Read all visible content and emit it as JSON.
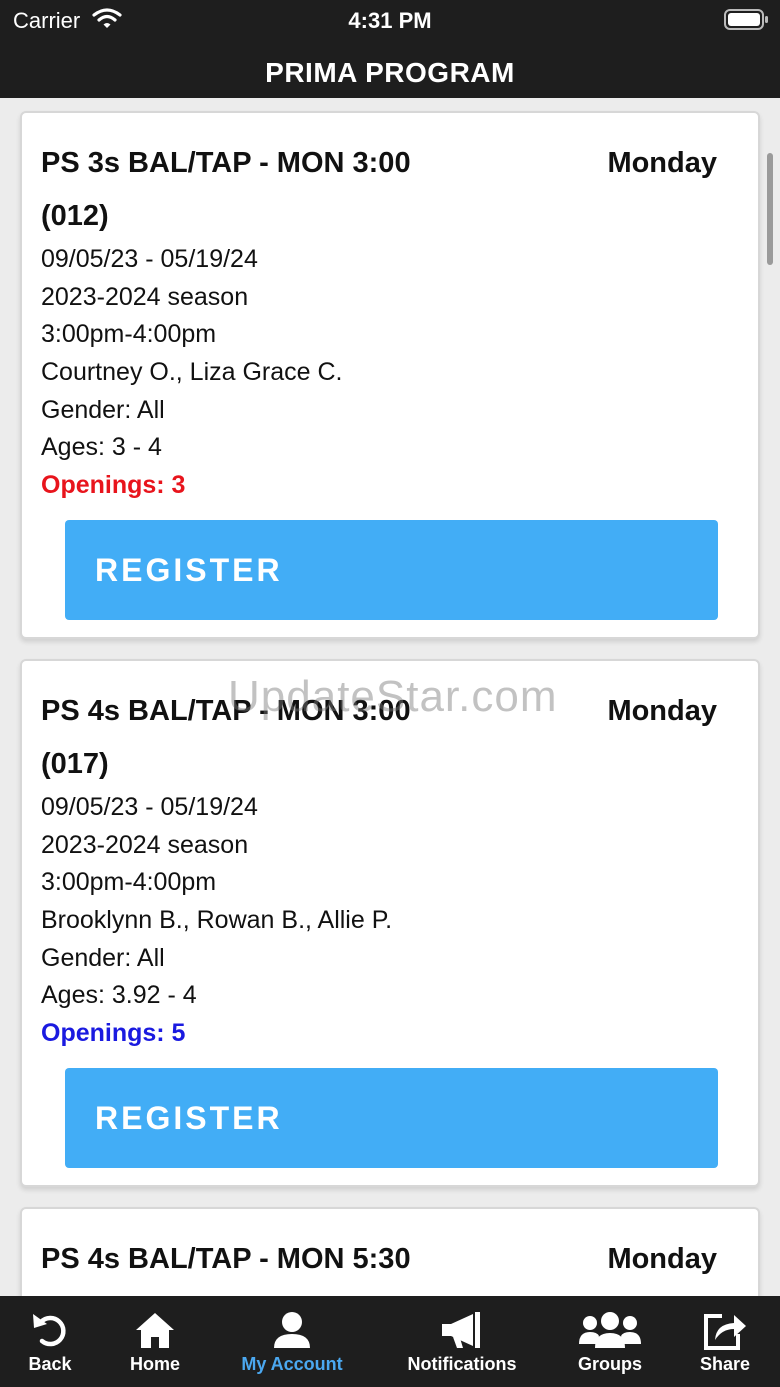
{
  "status": {
    "carrier": "Carrier",
    "time": "4:31 PM"
  },
  "header": {
    "title": "PRIMA PROGRAM"
  },
  "colors": {
    "accent": "#42adf6",
    "openings_low": "#e8141c",
    "openings_ok": "#1a1ae0",
    "bar": "#1e1e1e",
    "active_tab": "#4ba8f0"
  },
  "classes": [
    {
      "title": "PS 3s BAL/TAP - MON 3:00 (012)",
      "day": "Monday",
      "dates": "09/05/23 - 05/19/24",
      "season": "2023-2024 season",
      "time": "3:00pm-4:00pm",
      "instructors": "Courtney O., Liza Grace C.",
      "gender": "Gender: All",
      "ages": "Ages: 3 - 4",
      "openings": "Openings: 3",
      "register_label": "REGISTER"
    },
    {
      "title": "PS 4s BAL/TAP - MON 3:00 (017)",
      "day": "Monday",
      "dates": "09/05/23 - 05/19/24",
      "season": "2023-2024 season",
      "time": "3:00pm-4:00pm",
      "instructors": "Brooklynn B., Rowan B., Allie P.",
      "gender": "Gender: All",
      "ages": "Ages: 3.92 - 4",
      "openings": "Openings: 5",
      "register_label": "REGISTER"
    },
    {
      "title": "PS 4s BAL/TAP - MON 5:30",
      "day": "Monday"
    }
  ],
  "watermark": "UpdateStar.com",
  "tabbar": {
    "items": [
      {
        "label": "Back",
        "icon": "back-arrow-icon"
      },
      {
        "label": "Home",
        "icon": "home-icon"
      },
      {
        "label": "My Account",
        "icon": "person-icon",
        "active": true
      },
      {
        "label": "Notifications",
        "icon": "megaphone-icon"
      },
      {
        "label": "Groups",
        "icon": "group-icon"
      },
      {
        "label": "Share",
        "icon": "share-icon"
      }
    ]
  }
}
